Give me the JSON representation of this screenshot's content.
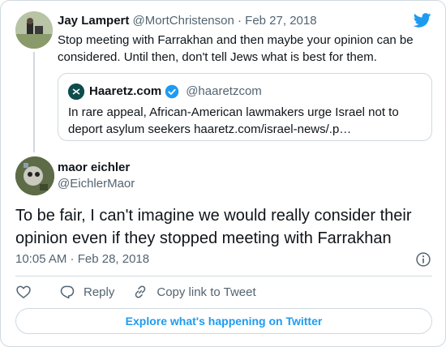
{
  "colors": {
    "accent": "#1d9bf0",
    "muted": "#536471",
    "border": "#cfd9de",
    "text": "#0f1419"
  },
  "parent_tweet": {
    "name": "Jay Lampert",
    "handle": "@MortChristenson",
    "separator": "·",
    "date": "Feb 27, 2018",
    "text": "Stop meeting with Farrakhan and then maybe your opinion can be considered. Until then, don't tell Jews what is best for them."
  },
  "quoted_tweet": {
    "name": "Haaretz.com",
    "handle": "@haaretzcom",
    "icon": "verified-badge-icon",
    "text": "In rare appeal, African-American lawmakers urge Israel not to deport asylum seekers haaretz.com/israel-news/.p…"
  },
  "main_tweet": {
    "name": "maor eichler",
    "handle": "@EichlerMaor",
    "text": "To be fair, I can't imagine we would really consider their opinion even if they stopped meeting with Farrakhan",
    "timestamp": "10:05 AM · Feb 28, 2018"
  },
  "actions": {
    "reply_label": "Reply",
    "copy_link_label": "Copy link to Tweet"
  },
  "explore_label": "Explore what's happening on Twitter"
}
